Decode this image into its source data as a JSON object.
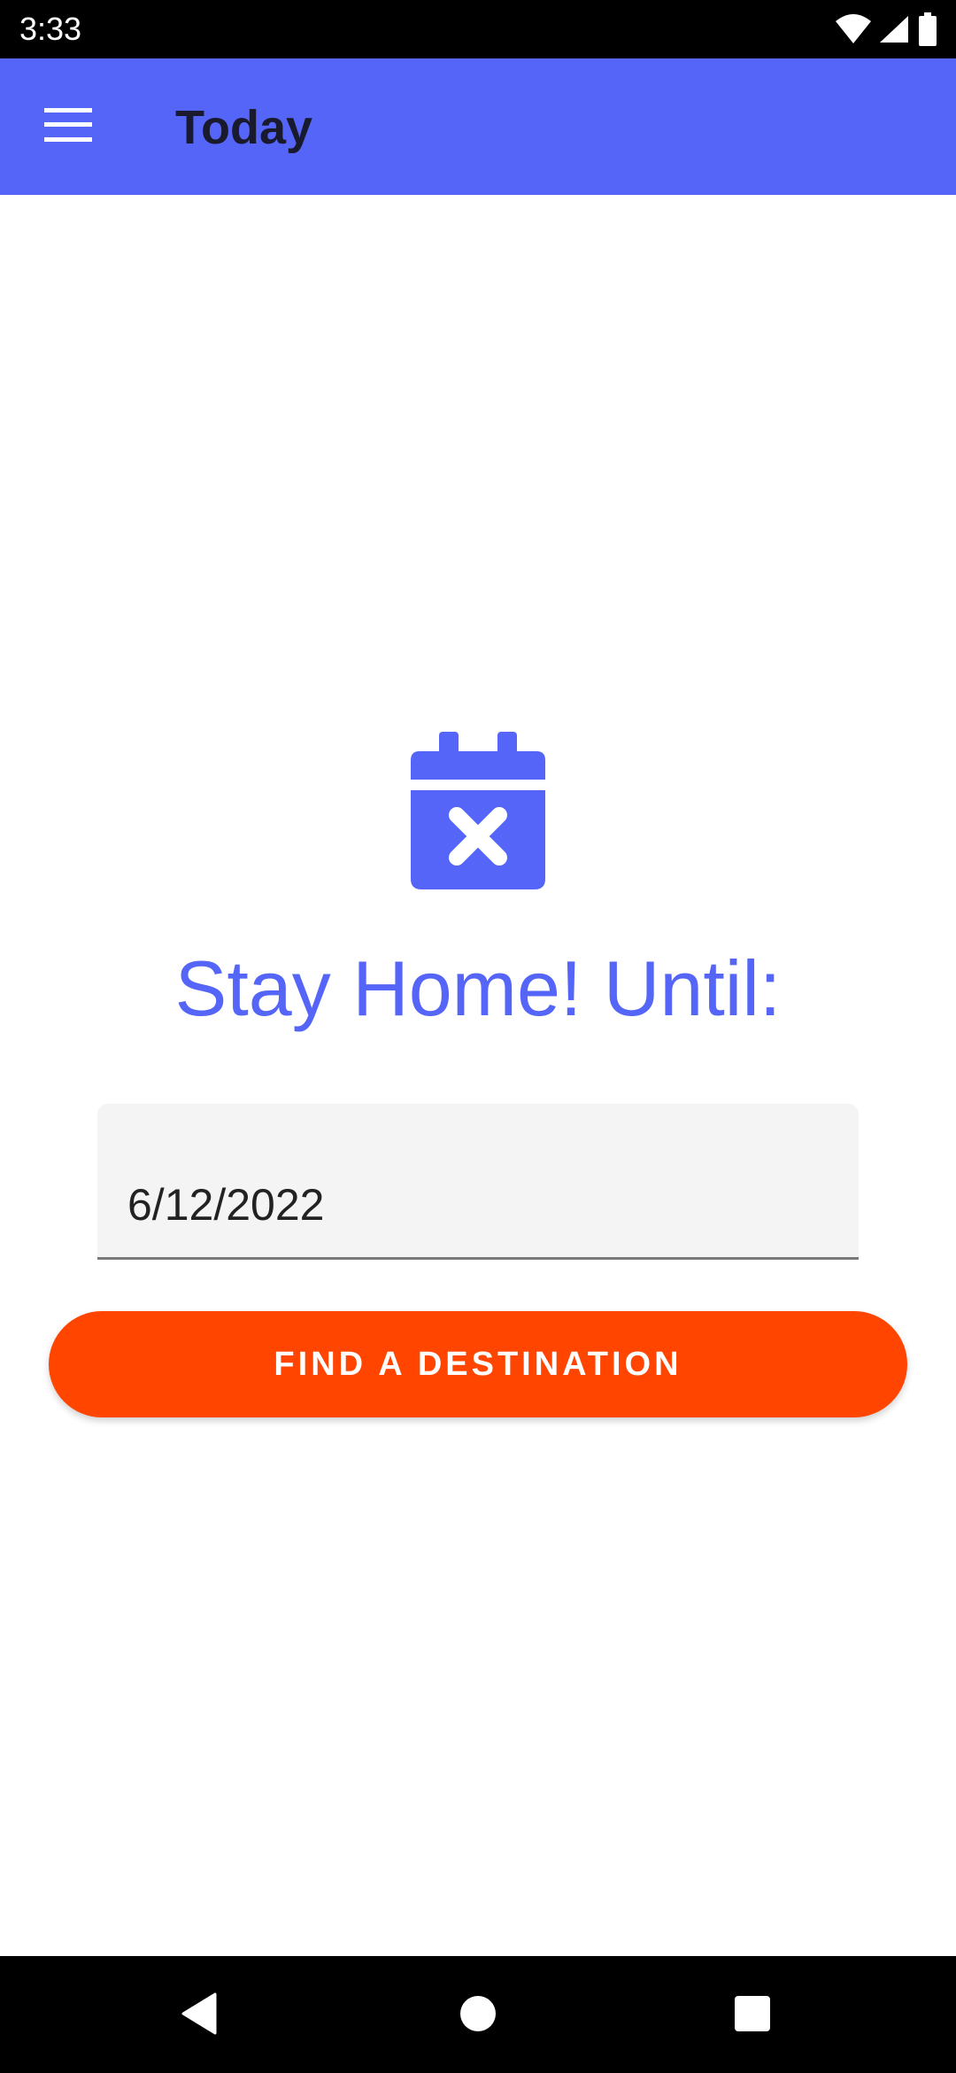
{
  "status_bar": {
    "time": "3:33",
    "icons": [
      "wifi-icon",
      "signal-icon",
      "battery-icon"
    ]
  },
  "app_bar": {
    "title": "Today",
    "menu_icon": "hamburger-menu-icon",
    "background_color": "#5565f7"
  },
  "main": {
    "icon": "calendar-x-icon",
    "headline": "Stay Home! Until:",
    "date_field": {
      "value": "6/12/2022"
    },
    "find_button": {
      "label": "FIND A DESTINATION",
      "color": "#ff4500"
    }
  },
  "nav_bar": {
    "buttons": [
      "back-icon",
      "home-icon",
      "recents-icon"
    ]
  }
}
